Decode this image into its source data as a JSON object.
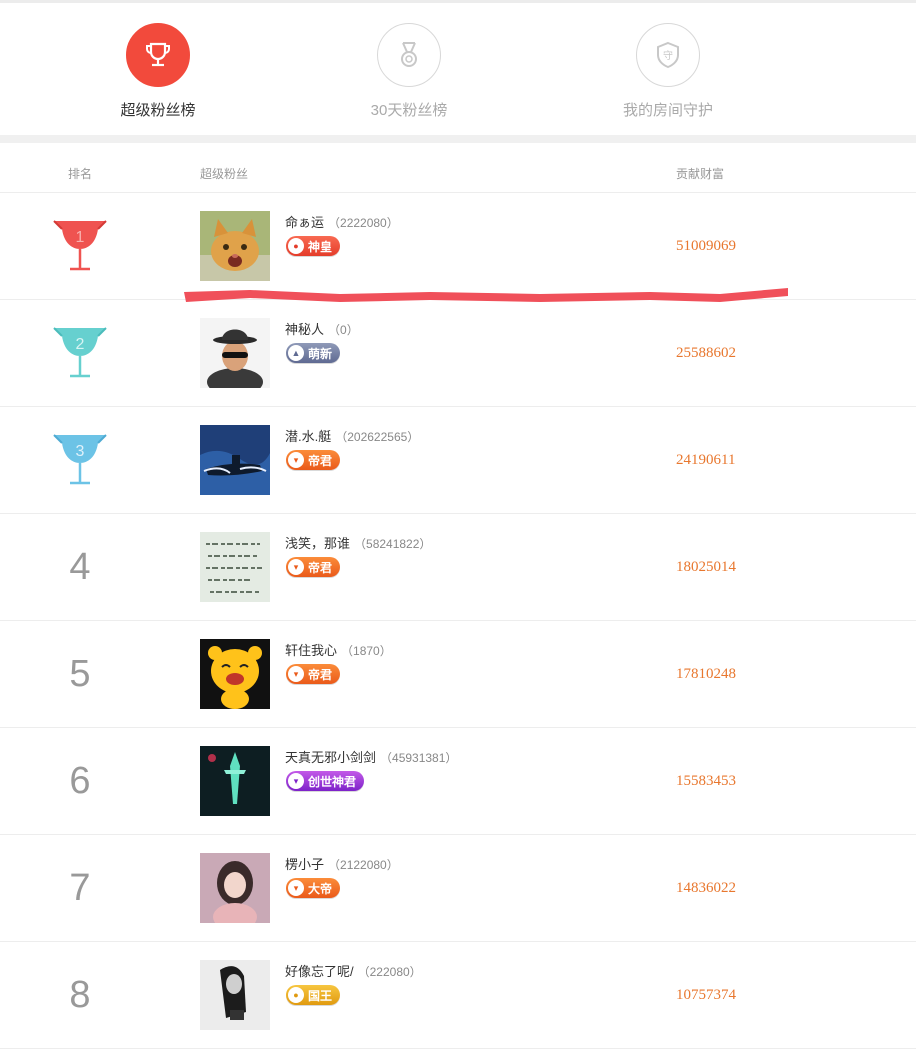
{
  "tabs": [
    {
      "label": "超级粉丝榜",
      "icon": "trophy-icon",
      "active": true
    },
    {
      "label": "30天粉丝榜",
      "icon": "medal-icon",
      "active": false
    },
    {
      "label": "我的房间守护",
      "icon": "shield-icon",
      "active": false
    }
  ],
  "table": {
    "headers": {
      "rank": "排名",
      "fan": "超级粉丝",
      "wealth": "贡献财富"
    },
    "rows": [
      {
        "rank": "1",
        "name": "命ぁ运",
        "uid": "（2222080）",
        "badge": "神皇",
        "wealth": "51009069",
        "avatar": "cat-avatar"
      },
      {
        "rank": "2",
        "name": "神秘人",
        "uid": "（0）",
        "badge": "萌新",
        "wealth": "25588602",
        "avatar": "mystery-man-avatar"
      },
      {
        "rank": "3",
        "name": "潜.水.艇",
        "uid": "（202622565）",
        "badge": "帝君",
        "wealth": "24190611",
        "avatar": "submarine-avatar"
      },
      {
        "rank": "4",
        "name": "浅笑，那谁",
        "uid": "（58241822）",
        "badge": "帝君",
        "wealth": "18025014",
        "avatar": "handwriting-avatar"
      },
      {
        "rank": "5",
        "name": "轩住我心",
        "uid": "（1870）",
        "badge": "帝君",
        "wealth": "17810248",
        "avatar": "cartoon-avatar"
      },
      {
        "rank": "6",
        "name": "天真无邪小剑剑",
        "uid": "（45931381）",
        "badge": "创世神君",
        "wealth": "15583453",
        "avatar": "sword-avatar"
      },
      {
        "rank": "7",
        "name": "楞小子",
        "uid": "（2122080）",
        "badge": "大帝",
        "wealth": "14836022",
        "avatar": "girl-avatar"
      },
      {
        "rank": "8",
        "name": "好像忘了呢/",
        "uid": "（222080）",
        "badge": "国王",
        "wealth": "10757374",
        "avatar": "bw-girl-avatar"
      }
    ]
  },
  "colors": {
    "accent": "#f24a3c",
    "wealth": "#e8772e",
    "trophy_gold": "#ef5350",
    "trophy_silver": "#66d0cf",
    "trophy_bronze": "#6cc3e6"
  }
}
